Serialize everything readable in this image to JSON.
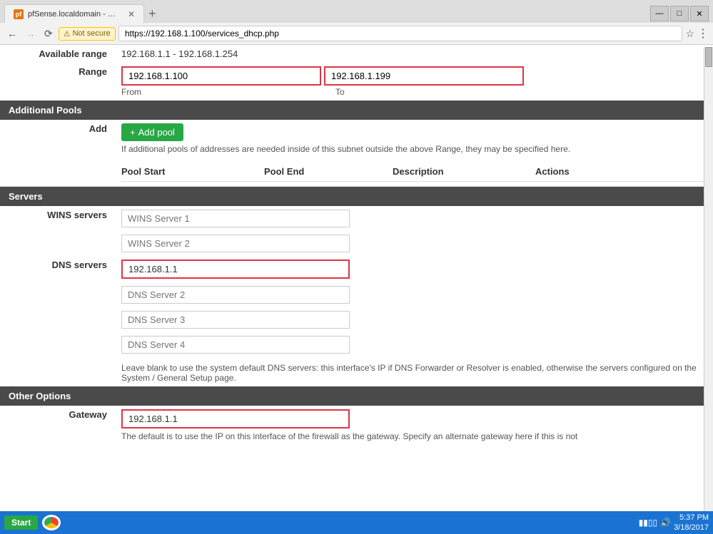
{
  "browser": {
    "tab_title": "pfSense.localdomain - Ser...",
    "url": "https://192.168.1.100/services_dhcp.php",
    "security_label": "Not secure"
  },
  "available_range": {
    "label": "Available range",
    "value": "192.168.1.1 - 192.168.1.254"
  },
  "range": {
    "label": "Range",
    "from_value": "192.168.1.100",
    "to_value": "192.168.1.199",
    "from_label": "From",
    "to_label": "To"
  },
  "additional_pools": {
    "section_title": "Additional Pools",
    "add_label": "Add",
    "add_pool_btn": "+ Add pool",
    "description": "If additional pools of addresses are needed inside of this subnet outside the above Range, they may be specified here.",
    "col_pool_start": "Pool Start",
    "col_pool_end": "Pool End",
    "col_description": "Description",
    "col_actions": "Actions"
  },
  "servers": {
    "section_title": "Servers",
    "wins_label": "WINS servers",
    "wins1_placeholder": "WINS Server 1",
    "wins2_placeholder": "WINS Server 2",
    "dns_label": "DNS servers",
    "dns1_value": "192.168.1.1",
    "dns2_placeholder": "DNS Server 2",
    "dns3_placeholder": "DNS Server 3",
    "dns4_placeholder": "DNS Server 4",
    "dns_help": "Leave blank to use the system default DNS servers: this interface's IP if DNS Forwarder or Resolver is enabled, otherwise the servers configured on the System / General Setup page."
  },
  "other_options": {
    "section_title": "Other Options",
    "gateway_label": "Gateway",
    "gateway_value": "192.168.1.1",
    "gateway_help": "The default is to use the IP on this interface of the firewall as the gateway. Specify an alternate gateway here if this is not"
  },
  "taskbar": {
    "start_label": "Start",
    "time": "5:37 PM",
    "date": "3/18/2017"
  }
}
